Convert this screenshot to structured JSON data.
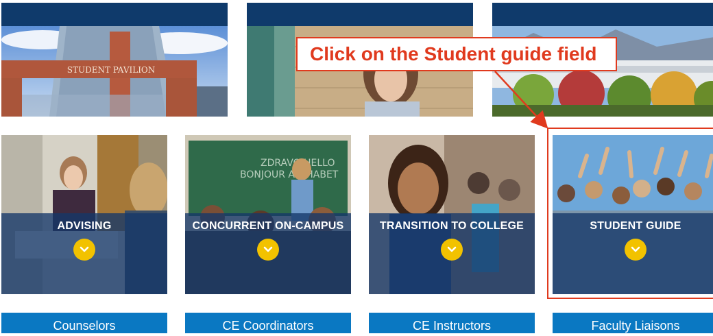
{
  "annotation": {
    "instruction": "Click on the Student guide field",
    "color": "#e03a1e"
  },
  "top_cards": [
    {
      "image_label": "STUDENT PAVILION"
    },
    {
      "image_label": ""
    },
    {
      "image_label": ""
    }
  ],
  "tiles": [
    {
      "title": "ADVISING",
      "icon": "chevron-down-icon"
    },
    {
      "title": "CONCURRENT ON-CAMPUS",
      "icon": "chevron-down-icon"
    },
    {
      "title": "TRANSITION TO COLLEGE",
      "icon": "chevron-down-icon"
    },
    {
      "title": "STUDENT GUIDE",
      "icon": "chevron-down-icon"
    }
  ],
  "bottom_buttons": [
    {
      "label": "Counselors"
    },
    {
      "label": "CE Coordinators"
    },
    {
      "label": "CE Instructors"
    },
    {
      "label": "Faculty Liaisons"
    }
  ],
  "colors": {
    "navy": "#0f3a6b",
    "overlay": "#14376a",
    "accent_yellow": "#f2c200",
    "button_blue": "#0a78c2"
  }
}
